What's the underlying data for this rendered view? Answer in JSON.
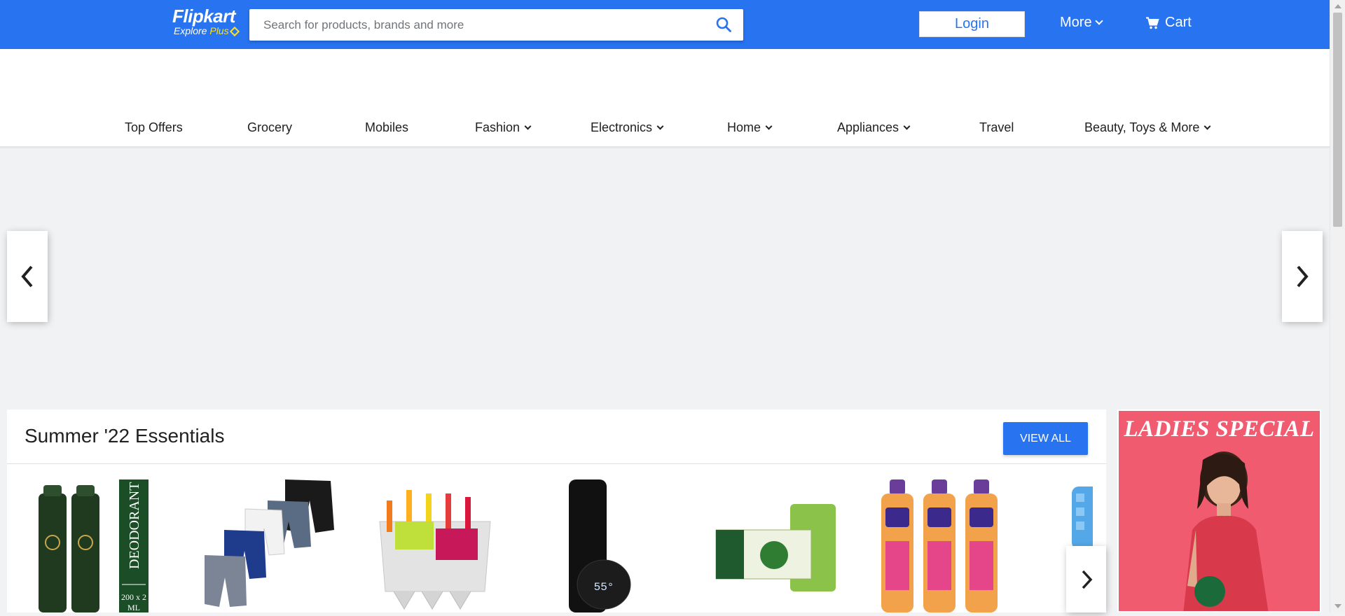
{
  "header": {
    "brand": "Flipkart",
    "tagline": "Explore",
    "tagline_plus": "Plus",
    "search_placeholder": "Search for products, brands and more",
    "login_label": "Login",
    "more_label": "More",
    "cart_label": "Cart"
  },
  "nav": {
    "items": [
      {
        "label": "Top Offers"
      },
      {
        "label": "Grocery"
      },
      {
        "label": "Mobiles"
      },
      {
        "label": "Fashion"
      },
      {
        "label": "Electronics"
      },
      {
        "label": "Home"
      },
      {
        "label": "Appliances"
      },
      {
        "label": "Travel"
      },
      {
        "label": "Beauty, Toys & More"
      }
    ]
  },
  "essentials": {
    "title": "Summer '22 Essentials",
    "view_all_label": "VIEW ALL",
    "products": [
      {
        "icon": "deodorant-image",
        "label_text": "DEODORANT",
        "size_text": "200 x 2",
        "unit_text": "ML"
      },
      {
        "icon": "shorts-image"
      },
      {
        "icon": "ice-mold-image"
      },
      {
        "icon": "smart-bottle-image",
        "display_text": "55°"
      },
      {
        "icon": "soap-image"
      },
      {
        "icon": "face-wash-image"
      },
      {
        "icon": "ice-tray-image"
      }
    ]
  },
  "ad": {
    "title": "LADIES SPECIAL"
  },
  "colors": {
    "brand_blue": "#2874f0",
    "plus_yellow": "#ffe11b",
    "ad_pink": "#f05b70"
  }
}
